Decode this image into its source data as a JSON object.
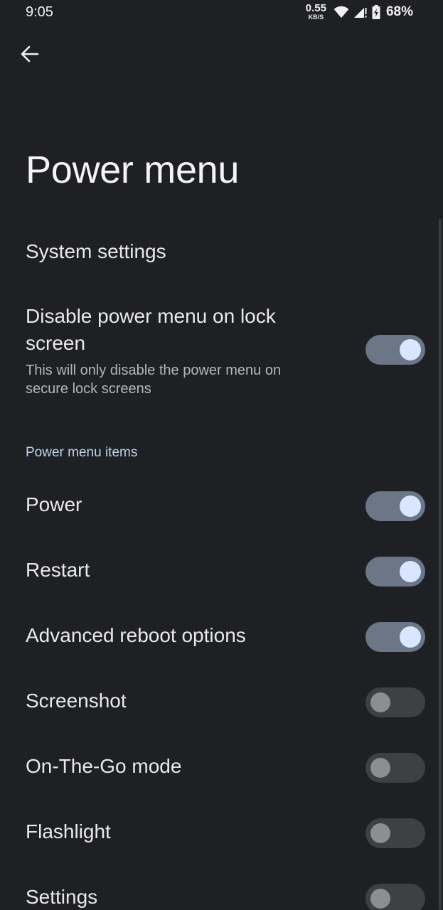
{
  "status_bar": {
    "time": "9:05",
    "net_speed_value": "0.55",
    "net_speed_unit": "KB/S",
    "battery_percent": "68%"
  },
  "header": {
    "title": "Power menu"
  },
  "system_settings": {
    "label": "System settings"
  },
  "disable_lock": {
    "title": "Disable power menu on lock screen",
    "subtitle": "This will only disable the power menu on secure lock screens",
    "enabled": true
  },
  "section": {
    "header": "Power menu items"
  },
  "items": [
    {
      "label": "Power",
      "enabled": true
    },
    {
      "label": "Restart",
      "enabled": true
    },
    {
      "label": "Advanced reboot options",
      "enabled": true
    },
    {
      "label": "Screenshot",
      "enabled": false
    },
    {
      "label": "On-The-Go mode",
      "enabled": false
    },
    {
      "label": "Flashlight",
      "enabled": false
    },
    {
      "label": "Settings",
      "enabled": false
    }
  ],
  "icons": {
    "back": "arrow-back-icon",
    "wifi": "wifi-icon",
    "signal": "signal-icon",
    "battery": "battery-charging-icon"
  },
  "colors": {
    "background": "#1f2023",
    "toggle_on_track": "#6b7687",
    "toggle_on_knob": "#d9e6ff",
    "toggle_off_track": "#3f4043",
    "toggle_off_knob": "#8d8e92",
    "section_header": "#bcd4f2"
  }
}
